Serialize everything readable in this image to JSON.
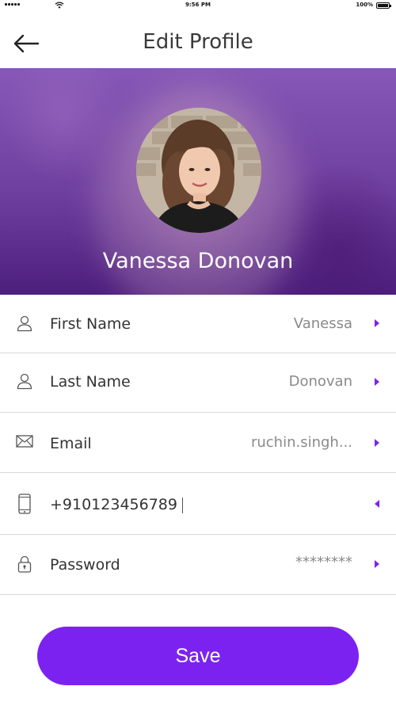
{
  "status_bar": {
    "time": "9:56 PM",
    "battery": "100%"
  },
  "header": {
    "title": "Edit Profile",
    "back_icon": "arrow-left-icon"
  },
  "profile": {
    "name": "Vanessa Donovan",
    "hero_color": "#6f3f9f"
  },
  "fields": [
    {
      "icon": "user-icon",
      "label": "First Name",
      "value": "Vanessa"
    },
    {
      "icon": "user-icon",
      "label": "Last Name",
      "value": "Donovan"
    },
    {
      "icon": "mail-icon",
      "label": "Email",
      "value": "ruchin.singh..."
    },
    {
      "icon": "phone-icon",
      "label": "",
      "value": "+910123456789"
    },
    {
      "icon": "lock-icon",
      "label": "Password",
      "value": "********"
    }
  ],
  "save": {
    "label": "Save",
    "color": "#7c22f0"
  },
  "accent_color": "#7c22f0"
}
